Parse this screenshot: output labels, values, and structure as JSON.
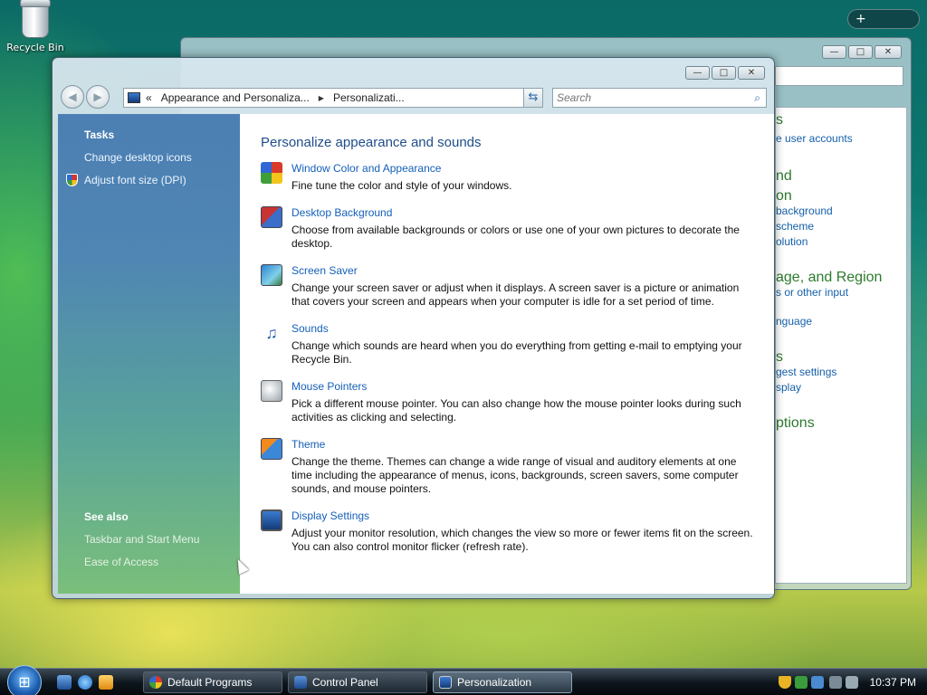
{
  "desktop": {
    "recycle_bin_label": "Recycle Bin",
    "gadget_symbol": "+"
  },
  "back_window": {
    "lines": [
      {
        "text": "s",
        "kind": "head"
      },
      {
        "text": "e user accounts",
        "kind": "link"
      },
      {
        "text": "nd",
        "kind": "head"
      },
      {
        "text": "on",
        "kind": "head"
      },
      {
        "text": "background",
        "kind": "link"
      },
      {
        "text": "scheme",
        "kind": "link"
      },
      {
        "text": "olution",
        "kind": "link"
      },
      {
        "text": "age, and Region",
        "kind": "head"
      },
      {
        "text": "s or other input",
        "kind": "link"
      },
      {
        "text": "nguage",
        "kind": "link"
      },
      {
        "text": "s",
        "kind": "head"
      },
      {
        "text": "gest settings",
        "kind": "link"
      },
      {
        "text": "splay",
        "kind": "link"
      },
      {
        "text": "ptions",
        "kind": "head"
      }
    ]
  },
  "window": {
    "caption": {
      "minimize": "—",
      "maximize": "□",
      "close": "✕"
    },
    "nav": {
      "back": "◀",
      "forward": "▶"
    },
    "address": {
      "chevron": "«",
      "crumbs": [
        "Appearance and Personaliza...",
        "Personalizati..."
      ],
      "separator": "▶",
      "dropdown": "▼",
      "refresh": "⇆"
    },
    "search": {
      "placeholder": "Search",
      "icon": "⌕"
    }
  },
  "sidebar": {
    "tasks_title": "Tasks",
    "tasks": [
      "Change desktop icons",
      "Adjust font size (DPI)"
    ],
    "see_also_title": "See also",
    "see_also": [
      "Taskbar and Start Menu",
      "Ease of Access"
    ]
  },
  "content": {
    "heading": "Personalize appearance and sounds",
    "items": [
      {
        "title": "Window Color and Appearance",
        "desc": "Fine tune the color and style of your windows.",
        "icon": "window-color-icon"
      },
      {
        "title": "Desktop Background",
        "desc": "Choose from available backgrounds or colors or use one of your own pictures to decorate the desktop.",
        "icon": "desktop-background-icon"
      },
      {
        "title": "Screen Saver",
        "desc": "Change your screen saver or adjust when it displays. A screen saver is a picture or animation that covers your screen and appears when your computer is idle for a set period of time.",
        "icon": "screen-saver-icon"
      },
      {
        "title": "Sounds",
        "desc": "Change which sounds are heard when you do everything from getting e-mail to emptying your Recycle Bin.",
        "icon": "sounds-icon"
      },
      {
        "title": "Mouse Pointers",
        "desc": "Pick a different mouse pointer. You can also change how the mouse pointer looks during such activities as clicking and selecting.",
        "icon": "mouse-pointers-icon"
      },
      {
        "title": "Theme",
        "desc": "Change the theme. Themes can change a wide range of visual and auditory elements at one time including the appearance of menus, icons, backgrounds, screen savers, some computer sounds, and mouse pointers.",
        "icon": "theme-icon"
      },
      {
        "title": "Display Settings",
        "desc": "Adjust your monitor resolution, which changes the view so more or fewer items fit on the screen. You can also control monitor flicker (refresh rate).",
        "icon": "display-settings-icon"
      }
    ]
  },
  "taskbar": {
    "tasks": [
      "Default Programs",
      "Control Panel",
      "Personalization"
    ],
    "active_task": "Personalization",
    "clock": "10:37 PM"
  },
  "colors": {
    "link": "#1560b8",
    "heading": "#1f4d8a",
    "back_heading": "#2d7a2d"
  }
}
